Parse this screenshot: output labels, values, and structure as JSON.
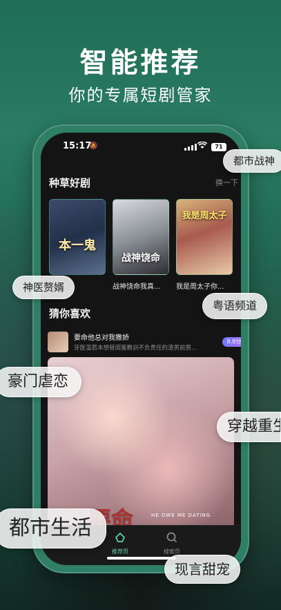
{
  "headline": {
    "title": "智能推荐",
    "subtitle": "你的专属短剧管家"
  },
  "status_bar": {
    "time": "15:17",
    "battery": "71"
  },
  "section_recommend": {
    "title": "种草好剧",
    "refresh_label": "换一下",
    "posters": [
      {
        "overlay": "本一鬼",
        "caption": ""
      },
      {
        "overlay": "战神饶命",
        "caption": "战神饶命我真..."
      },
      {
        "overlay": "我是周太子",
        "caption": "我是周太子你..."
      }
    ]
  },
  "section_guess": {
    "title": "猜你喜欢",
    "item": {
      "title": "要命他总对我撒娇",
      "description": "牙医温若本想替闺蜜教训不负责任的渣男前男...",
      "score": "8.8分"
    },
    "feature": {
      "overlay_title": "要命",
      "overlay_sub": "HE OWE ME DATING"
    }
  },
  "tabbar": {
    "tabs": [
      {
        "label": "推荐页",
        "icon": "recommend-icon",
        "active": true
      },
      {
        "label": "搜索页",
        "icon": "search-icon",
        "active": false
      }
    ]
  },
  "genre_tags": {
    "dushi_zhanshen": "都市战神",
    "shenyi_zhuixu": "神医赘婿",
    "yueyu_pindao": "粤语频道",
    "haomen_nuelian": "豪门虐恋",
    "chuanyue_chongsheng": "穿越重生",
    "dushi_shenghuo": "都市生活",
    "xianyan_tianchong": "现言甜宠"
  },
  "colors": {
    "accent_green": "#2f7e66",
    "score_gradient_start": "#6b7cff",
    "score_gradient_end": "#b46bff",
    "active_tab": "#5fd3a6"
  }
}
